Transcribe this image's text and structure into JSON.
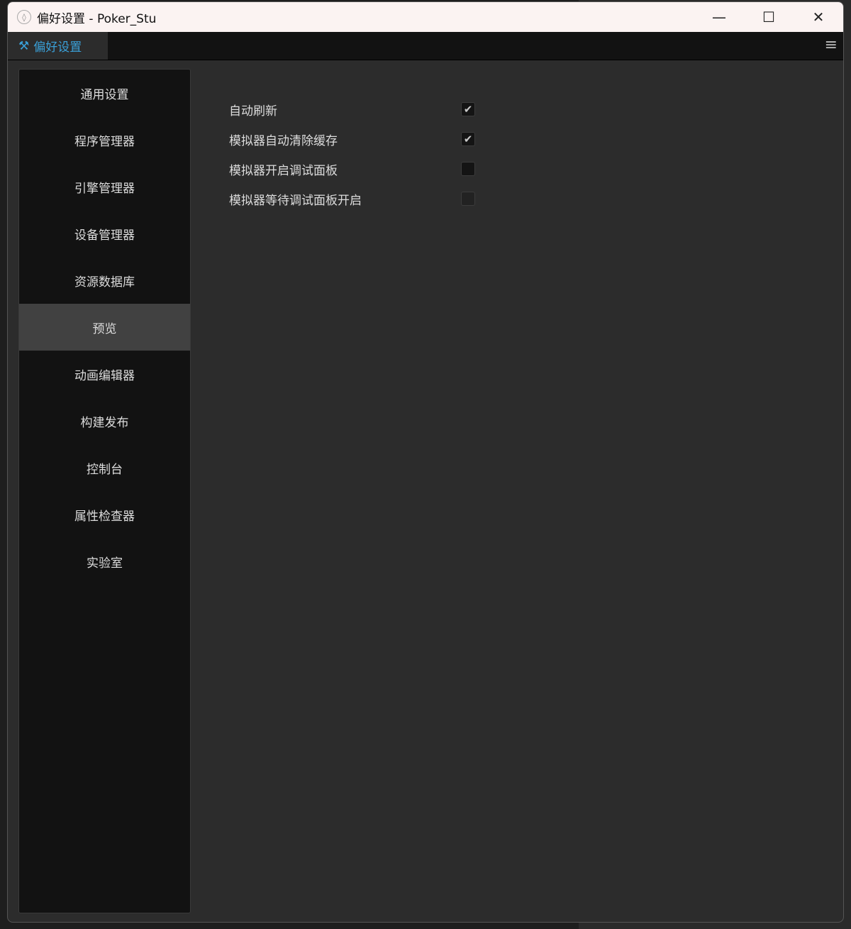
{
  "window": {
    "title": "偏好设置 - Poker_Stu",
    "icon": "droplet-icon"
  },
  "tab": {
    "label": "偏好设置",
    "icon": "tools-icon"
  },
  "sidebar": {
    "items": [
      {
        "label": "通用设置"
      },
      {
        "label": "程序管理器"
      },
      {
        "label": "引擎管理器"
      },
      {
        "label": "设备管理器"
      },
      {
        "label": "资源数据库"
      },
      {
        "label": "预览",
        "active": true
      },
      {
        "label": "动画编辑器"
      },
      {
        "label": "构建发布"
      },
      {
        "label": "控制台"
      },
      {
        "label": "属性检查器"
      },
      {
        "label": "实验室"
      }
    ]
  },
  "settings": [
    {
      "label": "自动刷新",
      "checked": true,
      "enabled": true
    },
    {
      "label": "模拟器自动清除缓存",
      "checked": true,
      "enabled": true
    },
    {
      "label": "模拟器开启调试面板",
      "checked": false,
      "enabled": true
    },
    {
      "label": "模拟器等待调试面板开启",
      "checked": false,
      "enabled": false
    }
  ],
  "colors": {
    "accent": "#3aa0d8",
    "sidebar_active": "#414141"
  }
}
